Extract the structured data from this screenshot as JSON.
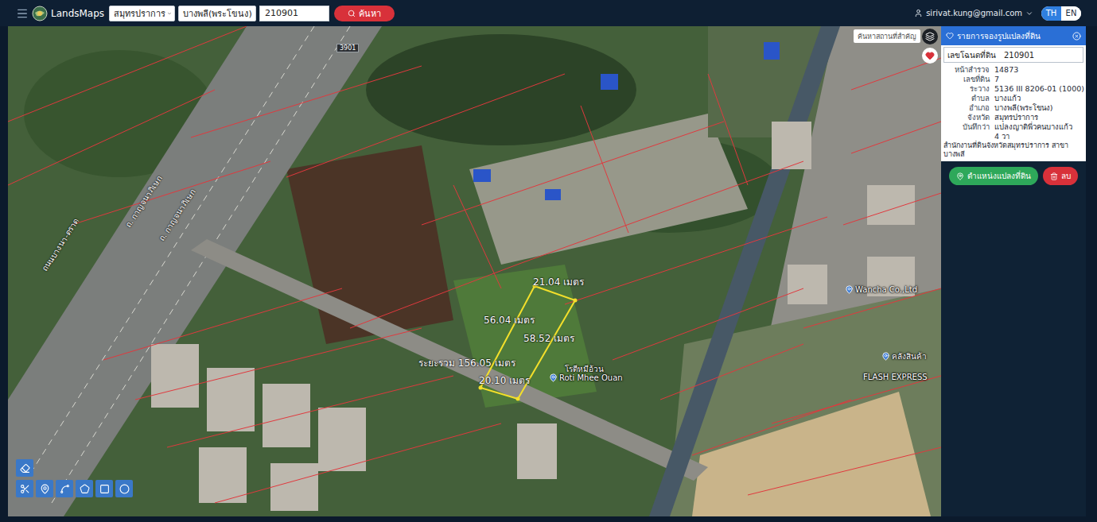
{
  "app": {
    "name": "LandsMaps"
  },
  "search": {
    "province": "สมุทรปราการ",
    "district": "บางพลี(พระโขนง)",
    "deed": "210901",
    "button": "ค้นหา"
  },
  "user": {
    "email": "sirivat.kung@gmail.com"
  },
  "languages": [
    {
      "label": "TH",
      "selected": true
    },
    {
      "label": "EN",
      "selected": false
    }
  ],
  "map": {
    "search_placeholder": "ค้นหาสถานที่สำคัญ",
    "favorite": true,
    "labels": [
      {
        "text": "3901",
        "kind": "shield"
      },
      {
        "text": "ถ. กาญจนาภิเษก",
        "kind": "road"
      },
      {
        "text": "ถ. กาญจนาภิเษก",
        "kind": "road"
      },
      {
        "text": "ถนนบางนา-ตราด",
        "kind": "road"
      },
      {
        "text": "โรตีหมีอ้วน",
        "kind": "caption"
      },
      {
        "text": "Roti Mhee Ouan",
        "kind": "place"
      },
      {
        "text": "Wancha Co.,Ltd",
        "kind": "place"
      },
      {
        "text": "คลังสินค้า",
        "kind": "place"
      },
      {
        "text": "FLASH EXPRESS",
        "kind": "caption"
      }
    ],
    "parcel": {
      "sides": [
        "21.04 เมตร",
        "56.04 เมตร",
        "58.52 เมตร",
        "20.10 เมตร"
      ],
      "total": "ระยะรวม 156.05 เมตร"
    }
  },
  "panel": {
    "title": "รายการจองรูปแปลงที่ดิน",
    "deed_label": "เลขโฉนดที่ดิน",
    "deed_value": "210901",
    "rows": [
      {
        "label": "หน้าสำรวจ",
        "value": "14873"
      },
      {
        "label": "เลขที่ดิน",
        "value": "7"
      },
      {
        "label": "ระวาง",
        "value": "5136 III 8206-01 (1000)"
      },
      {
        "label": "ตำบล",
        "value": "บางแก้ว"
      },
      {
        "label": "อำเภอ",
        "value": "บางพลี(พระโขนง)"
      },
      {
        "label": "จังหวัด",
        "value": "สมุทรปราการ"
      },
      {
        "label": "บันทึกว่า",
        "value": "แปลงญาติพี่วคนบางแก้ว"
      },
      {
        "label": "",
        "value": "4 วา"
      }
    ],
    "office": "สำนักงานที่ดินจังหวัดสมุทรปราการ สาขาบางพลี",
    "buttons": [
      {
        "label": "ตำแหน่งแปลงที่ดิน",
        "kind": "locate"
      },
      {
        "label": "ลบ",
        "kind": "delete"
      }
    ]
  }
}
